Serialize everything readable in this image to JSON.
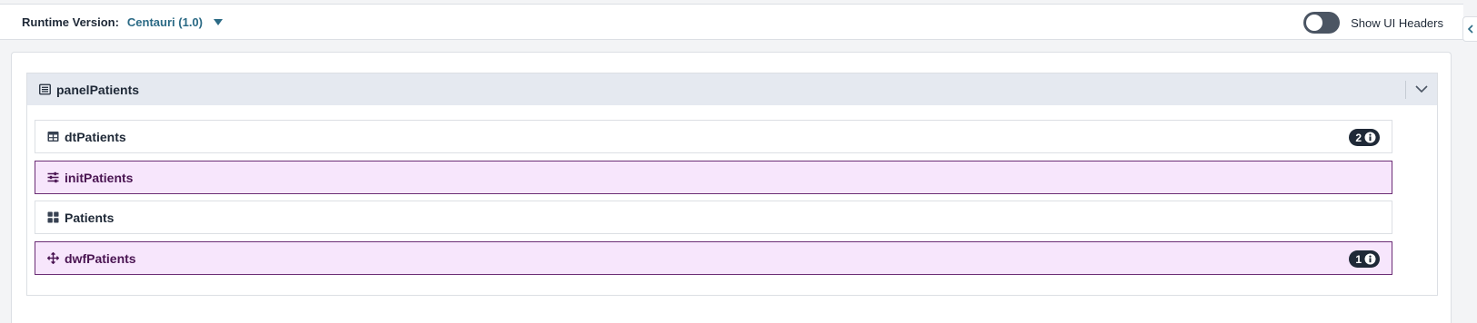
{
  "topbar": {
    "runtime_label": "Runtime Version:",
    "runtime_value": "Centauri (1.0)",
    "toggle_label": "Show UI Headers",
    "toggle_on": false
  },
  "panel": {
    "title": "panelPatients",
    "icon": "list-panel-icon",
    "collapse_icon": "chevron-down-icon"
  },
  "rows": [
    {
      "label": "dtPatients",
      "icon": "table-icon",
      "badge": "2"
    },
    {
      "label": "initPatients",
      "icon": "sliders-icon"
    },
    {
      "label": "Patients",
      "icon": "grid-icon"
    },
    {
      "label": "dwfPatients",
      "icon": "move-icon",
      "badge": "1"
    }
  ],
  "colors": {
    "accent": "#2b6a85",
    "purple_bg": "#f7e6fc",
    "purple_border": "#6b2d75",
    "header_bg": "#e5e9f0"
  }
}
